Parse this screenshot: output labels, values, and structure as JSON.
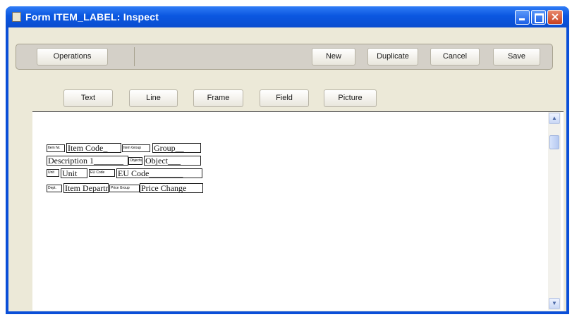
{
  "window": {
    "title": "Form ITEM_LABEL: Inspect"
  },
  "toolbar": {
    "operations_label": "Operations",
    "new_label": "New",
    "duplicate_label": "Duplicate",
    "cancel_label": "Cancel",
    "save_label": "Save"
  },
  "tools": [
    "Text",
    "Line",
    "Frame",
    "Field",
    "Picture"
  ],
  "form_items": {
    "row1": {
      "label1": "Item Nr.",
      "field1": "Item Code_",
      "label2": "Item Group",
      "field2": "Group__"
    },
    "row2": {
      "field1": "Description 1_______",
      "label1": "Objects",
      "field2": "Object___"
    },
    "row3": {
      "label1": "Unit",
      "field1": "Unit",
      "label2": "EU Code",
      "field2": "EU Code________"
    },
    "row4": {
      "label1": "Dept.",
      "field1": "Item Departm",
      "label2": "Price Group",
      "field2": "Price Change"
    }
  }
}
